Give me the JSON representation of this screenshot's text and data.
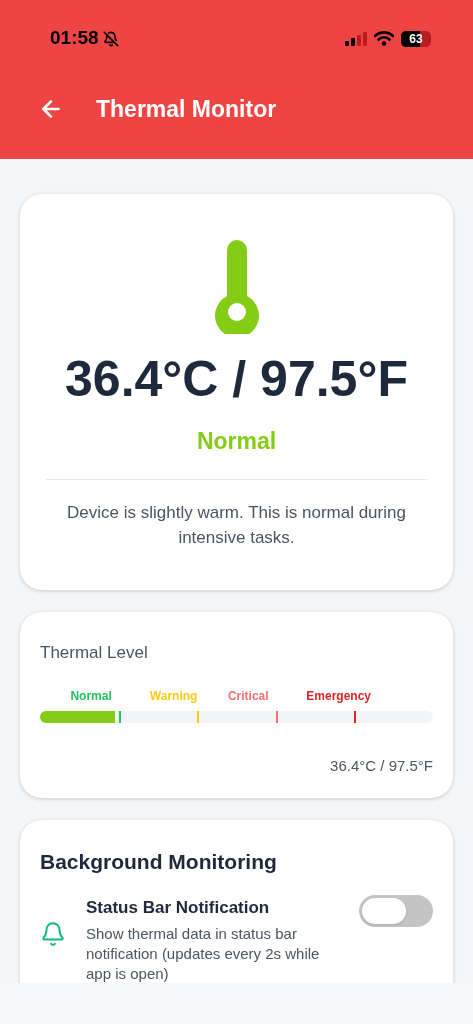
{
  "status_bar": {
    "time": "01:58",
    "battery": "63"
  },
  "header": {
    "title": "Thermal Monitor"
  },
  "summary": {
    "temperature": "36.4°C / 97.5°F",
    "status": "Normal",
    "message": "Device is slightly warm. This is normal during intensive tasks."
  },
  "thermal_level": {
    "title": "Thermal Level",
    "level": 0.19,
    "reading": "36.4°C / 97.5°F",
    "zones": [
      {
        "label": "Normal",
        "color": "#22c55e"
      },
      {
        "label": "Warning",
        "color": "#facc15"
      },
      {
        "label": "Critical",
        "color": "#f87171"
      },
      {
        "label": "Emergency",
        "color": "#dc2626"
      }
    ]
  },
  "background_monitoring": {
    "title": "Background Monitoring",
    "settings": [
      {
        "title": "Status Bar Notification",
        "description": "Show thermal data in status bar notification (updates every 2s while app is open)",
        "on": false
      }
    ]
  }
}
